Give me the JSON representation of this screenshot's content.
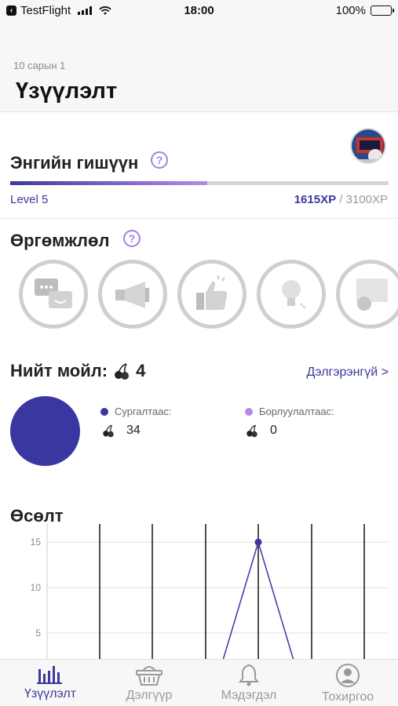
{
  "status_bar": {
    "carrier": "TestFlight",
    "time": "18:00",
    "battery": "100%"
  },
  "header": {
    "date": "10 сарын 1",
    "title": "Үзүүлэлт"
  },
  "membership": {
    "title": "Энгийн гишүүн",
    "help": "?",
    "level": "Level 5",
    "xp_current": "1615XP",
    "xp_sep": " / ",
    "xp_total": "3100XP",
    "progress": 0.52
  },
  "badges": {
    "title": "Өргөмжлөл",
    "help": "?",
    "items": [
      "chat-badge-icon",
      "megaphone-badge-icon",
      "thumbs-up-badge-icon",
      "lightbulb-badge-icon",
      "certificate-badge-icon"
    ]
  },
  "coins": {
    "title": "Нийт мойл:",
    "total": "4",
    "more": "Дэлгэрэнгүй >",
    "training_label": "Сургалтаас:",
    "training_value": "34",
    "sales_label": "Борлуулалтаас:",
    "sales_value": "0",
    "colors": {
      "training": "#3a37a0",
      "sales": "#b48be8"
    }
  },
  "growth": {
    "title": "Өсөлт"
  },
  "chart_data": {
    "type": "line",
    "y_ticks": [
      "15",
      "10",
      "5"
    ],
    "ylim": [
      0,
      17
    ],
    "points": [
      {
        "x": 0,
        "y": 0
      },
      {
        "x": 1,
        "y": 15
      },
      {
        "x": 2,
        "y": 0
      }
    ],
    "marker_point": 1,
    "color": "#3a37a0",
    "grid": true
  },
  "tabbar": {
    "tabs": [
      {
        "label": "Үзүүлэлт",
        "icon": "bar-chart-icon",
        "active": true
      },
      {
        "label": "Дэлгүүр",
        "icon": "basket-icon",
        "active": false
      },
      {
        "label": "Мэдэгдэл",
        "icon": "bell-icon",
        "active": false
      },
      {
        "label": "Тохиргоо",
        "icon": "user-icon",
        "active": false
      }
    ]
  }
}
